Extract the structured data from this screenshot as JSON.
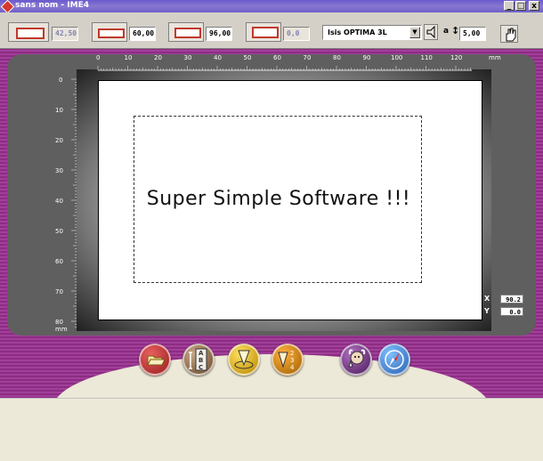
{
  "window": {
    "title": "sans nom - IME4",
    "min_btn": "_",
    "max_btn": "□",
    "close_btn": "x"
  },
  "toolbar": {
    "field1": "42,50",
    "field2": "60,00",
    "field3": "96,00",
    "field4": "0,0",
    "font_name": "Isis OPTIMA 3L",
    "size_value": "5,00",
    "size_prefix": "a"
  },
  "ruler": {
    "h_labels": [
      "0",
      "10",
      "20",
      "30",
      "40",
      "50",
      "60",
      "70",
      "80",
      "90",
      "100",
      "110",
      "120",
      "mm"
    ],
    "v_labels": [
      "0",
      "10",
      "20",
      "30",
      "40",
      "50",
      "60",
      "70",
      "80",
      "mm"
    ]
  },
  "canvas": {
    "sample_text": "Super Simple Software !!!"
  },
  "coords": {
    "x_label": "X",
    "x_value": "90.2",
    "y_label": "Y",
    "y_value": "0.0"
  },
  "colors": {
    "background_purple": "#8c2a80",
    "workspace_gray": "#5f5f5f",
    "titlebar": "#6a5acd"
  },
  "bottom_buttons": [
    {
      "name": "open-folder-icon",
      "color": "#b43232"
    },
    {
      "name": "abc-text-icon",
      "color": "#8a6a4a"
    },
    {
      "name": "engrave-tool-icon",
      "color": "#e0b000"
    },
    {
      "name": "fraction-tool-icon",
      "color": "#d08000"
    },
    {
      "name": "help-wizard-icon",
      "color": "#7a3a8a"
    },
    {
      "name": "compass-icon",
      "color": "#3a80d0"
    }
  ]
}
